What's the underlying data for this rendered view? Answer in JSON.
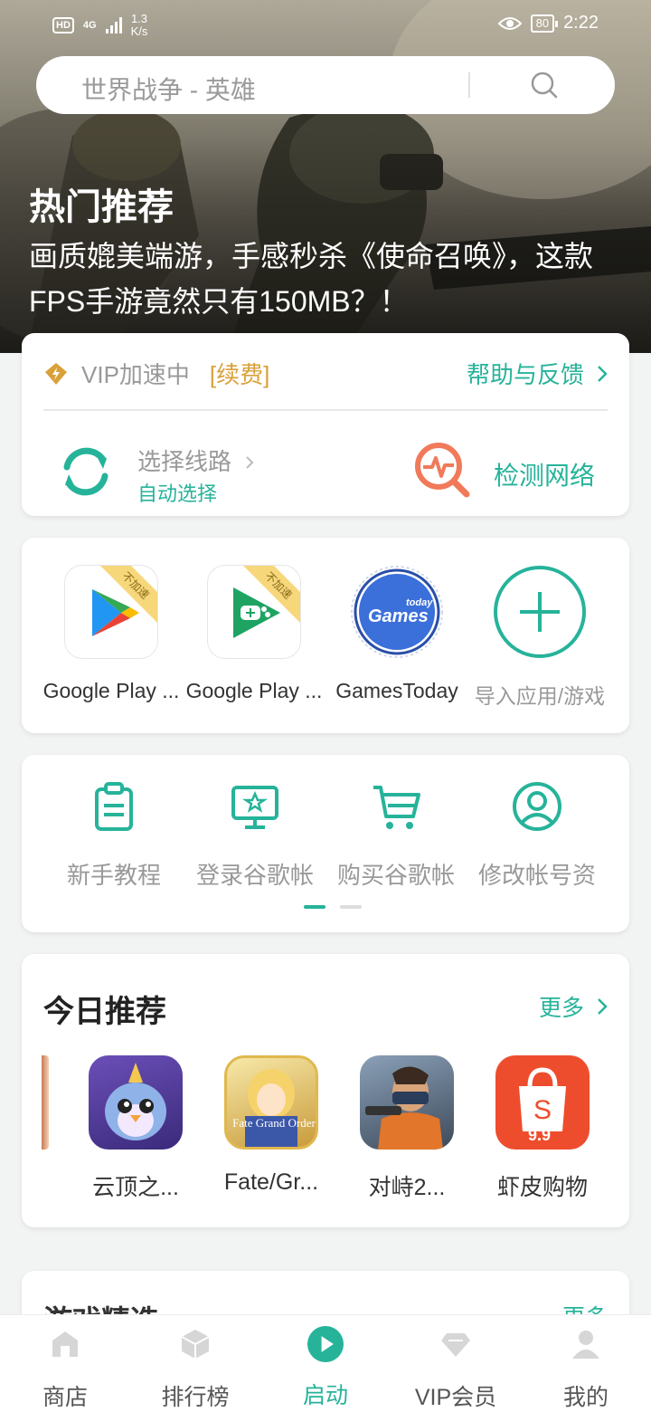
{
  "status_bar": {
    "hd": "HD",
    "network": "4G",
    "speed_top": "1.3",
    "speed_bottom": "K/s",
    "battery": "80",
    "time": "2:22"
  },
  "search": {
    "placeholder": "世界战争 - 英雄"
  },
  "banner": {
    "title": "热门推荐",
    "description": "画质媲美端游，手感秒杀《使命召唤》，这款FPS手游竟然只有150MB？！"
  },
  "vip": {
    "status": "VIP加速中",
    "renew": "[续费]",
    "help": "帮助与反馈",
    "route_label": "选择线路",
    "route_value": "自动选择",
    "detect": "检测网络"
  },
  "apps": [
    {
      "name": "Google Play ...",
      "badge": "不加速",
      "icon": "google-play-store-icon"
    },
    {
      "name": "Google Play ...",
      "badge": "不加速",
      "icon": "google-play-games-icon"
    },
    {
      "name": "GamesToday",
      "icon_text": "Games",
      "icon_text_small": "today",
      "icon": "gamestoday-icon"
    },
    {
      "name": "导入应用/游戏",
      "icon": "add-icon"
    }
  ],
  "tools": [
    {
      "label": "新手教程",
      "icon": "clipboard-icon"
    },
    {
      "label": "登录谷歌帐",
      "icon": "monitor-star-icon"
    },
    {
      "label": "购买谷歌帐",
      "icon": "cart-icon"
    },
    {
      "label": "修改帐号资",
      "icon": "user-circle-icon"
    }
  ],
  "recommend": {
    "title": "今日推荐",
    "more": "更多",
    "games": [
      {
        "name": "云顶之...",
        "icon": "tft-penguin-icon"
      },
      {
        "name": "Fate/Gr...",
        "icon": "fate-grand-order-icon",
        "icon_text": "Fate Grand Order"
      },
      {
        "name": "对峙2...",
        "icon": "standoff2-icon"
      },
      {
        "name": "虾皮购物",
        "icon": "shopee-icon",
        "icon_text": "9.9"
      }
    ]
  },
  "partial_card": {
    "title": "游戏精选",
    "more": "更多"
  },
  "tabs": [
    {
      "label": "商店",
      "icon": "store-icon",
      "active": false
    },
    {
      "label": "排行榜",
      "icon": "ranking-cube-icon",
      "active": false
    },
    {
      "label": "启动",
      "icon": "play-icon",
      "active": true
    },
    {
      "label": "VIP会员",
      "icon": "diamond-icon",
      "active": false
    },
    {
      "label": "我的",
      "icon": "person-icon",
      "active": false
    }
  ],
  "colors": {
    "accent": "#26b39a",
    "gold": "#d9a13a",
    "detect": "#f07a5a"
  }
}
